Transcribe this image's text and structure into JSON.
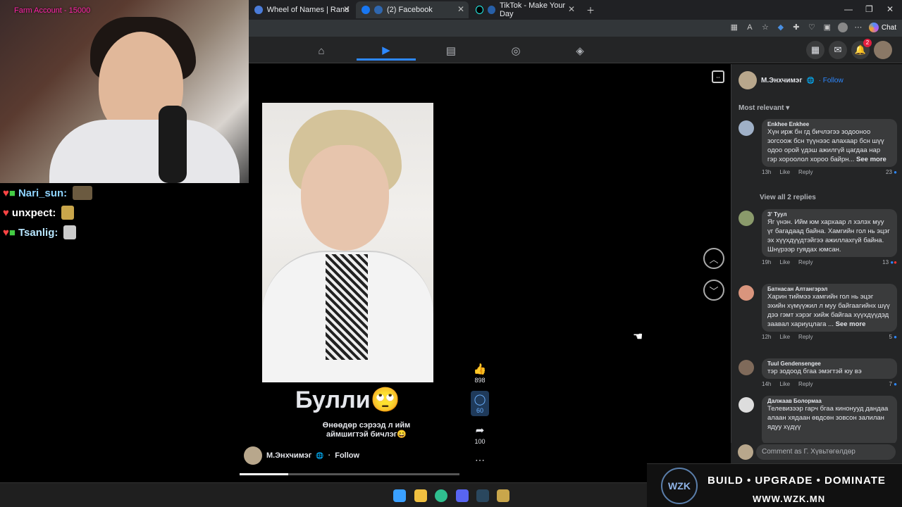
{
  "browser": {
    "tabs": [
      {
        "title": "Farm Account - 15000"
      },
      {
        "title": "Wheel of Names | Random name g"
      },
      {
        "title": "(2) Facebook"
      },
      {
        "title": "TikTok - Make Your Day"
      }
    ],
    "chat_label": "Chat"
  },
  "stream_chat": [
    {
      "user": "Nari_sun:",
      "color": "#8fd4ff"
    },
    {
      "user": "unxpect:",
      "color": "#ffffff"
    },
    {
      "user": "Tsanlig:",
      "color": "#b8e6ff"
    }
  ],
  "fb": {
    "notification_count": "2"
  },
  "reel": {
    "caption": "Булли🙄",
    "subcaption_line1": "Өнөөдөр сэрээд л ийм",
    "subcaption_line2": "аймшигтэй бичлэг😄",
    "author": "М.Энхчимэг",
    "follow": "Follow",
    "likes": "898",
    "comments": "60",
    "shares": "100",
    "progress_fraction": 0.22
  },
  "comments_panel": {
    "author": "М.Энхчимэг",
    "follow": "· Follow",
    "sort_label": "Most relevant",
    "view_replies": "View all 2 replies",
    "input_placeholder": "Comment as Г. Хүвьтөгөлдөр",
    "comments": [
      {
        "name": "Enkhee Enkhee",
        "text": "Хүн ирж бн гд бичлэгээ зодооноо зогсоож бсн түүнээс алахаар бсн шүү одоо орой үдэш ажилгүй цагдаа нар гэр хороолол хороо байрн...",
        "more": "See more",
        "time": "13h",
        "like": "Like",
        "reply": "Reply",
        "count": "23"
      },
      {
        "name": "З' Туул",
        "text": "Яг үнэн. Ийм юм хархаар л хэлэх муу үг багадаад байна. Хамгийн гол нь эцэг эх хүүхдүүдтэйгээ ажиллахгүй байна. Шнүрээр гуядах юмсан.",
        "more": "",
        "time": "19h",
        "like": "Like",
        "reply": "Reply",
        "count": "13"
      },
      {
        "name": "Батнасан Алтангэрэл",
        "text": "Харин тиймээ хамгийн гол нь эцэг эхийн хүмүүжил л муу байгаагийнх шүү дээ гэмт хэрэг хийж байгаа хүүхдүүдэд заавал хариуцлага ...",
        "more": "See more",
        "time": "12h",
        "like": "Like",
        "reply": "Reply",
        "count": "5"
      },
      {
        "name": "Tuul Gendensengee",
        "text": "тэр зодоод бгаа эмэгтэй юу вэ",
        "more": "",
        "time": "14h",
        "like": "Like",
        "reply": "Reply",
        "count": "7"
      },
      {
        "name": "Далжаав Болормаа",
        "text": "Телевизээр гарч бгаа кинонууд дандаа алаан хядаан өвдсөн зовсон залилан ядуу хүдүү",
        "more": "",
        "time": "",
        "like": "",
        "reply": "",
        "count": ""
      }
    ]
  },
  "promo": {
    "logo": "WZK",
    "tagline": "BUILD • UPGRADE • DOMINATE",
    "url": "WWW.WZK.MN"
  }
}
